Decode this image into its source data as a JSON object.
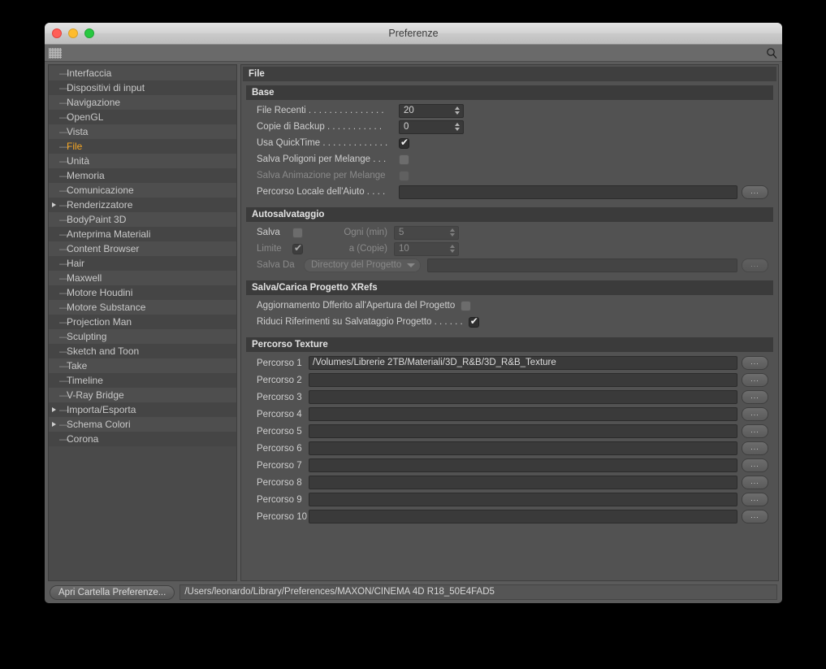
{
  "window": {
    "title": "Preferenze",
    "traffic_lights": [
      "close",
      "minimize",
      "zoom"
    ]
  },
  "search": {
    "icon": "search-icon"
  },
  "sidebar": {
    "items": [
      {
        "label": "Interfaccia",
        "expandable": false,
        "selected": false
      },
      {
        "label": "Dispositivi di input",
        "expandable": false,
        "selected": false
      },
      {
        "label": "Navigazione",
        "expandable": false,
        "selected": false
      },
      {
        "label": "OpenGL",
        "expandable": false,
        "selected": false
      },
      {
        "label": "Vista",
        "expandable": false,
        "selected": false
      },
      {
        "label": "File",
        "expandable": false,
        "selected": true
      },
      {
        "label": "Unità",
        "expandable": false,
        "selected": false
      },
      {
        "label": "Memoria",
        "expandable": false,
        "selected": false
      },
      {
        "label": "Comunicazione",
        "expandable": false,
        "selected": false
      },
      {
        "label": "Renderizzatore",
        "expandable": true,
        "selected": false
      },
      {
        "label": "BodyPaint 3D",
        "expandable": false,
        "selected": false
      },
      {
        "label": "Anteprima Materiali",
        "expandable": false,
        "selected": false
      },
      {
        "label": "Content Browser",
        "expandable": false,
        "selected": false
      },
      {
        "label": "Hair",
        "expandable": false,
        "selected": false
      },
      {
        "label": "Maxwell",
        "expandable": false,
        "selected": false
      },
      {
        "label": "Motore Houdini",
        "expandable": false,
        "selected": false
      },
      {
        "label": "Motore Substance",
        "expandable": false,
        "selected": false
      },
      {
        "label": "Projection Man",
        "expandable": false,
        "selected": false
      },
      {
        "label": "Sculpting",
        "expandable": false,
        "selected": false
      },
      {
        "label": "Sketch and Toon",
        "expandable": false,
        "selected": false
      },
      {
        "label": "Take",
        "expandable": false,
        "selected": false
      },
      {
        "label": "Timeline",
        "expandable": false,
        "selected": false
      },
      {
        "label": "V-Ray Bridge",
        "expandable": false,
        "selected": false
      },
      {
        "label": "Importa/Esporta",
        "expandable": true,
        "selected": false
      },
      {
        "label": "Schema Colori",
        "expandable": true,
        "selected": false
      },
      {
        "label": "Corona",
        "expandable": false,
        "selected": false
      }
    ],
    "selected_color": "#f5a623"
  },
  "main": {
    "pane_title": "File",
    "groups": [
      {
        "title": "Base",
        "rows": [
          {
            "label": "File Recenti . . . . . . . . . . . . . . .",
            "type": "stepper",
            "value": "20",
            "disabled": false,
            "width": 80
          },
          {
            "label": "Copie di Backup . . . . . . . . . . .",
            "type": "stepper",
            "value": "0",
            "disabled": false,
            "width": 80
          },
          {
            "label": "Usa QuickTime . . . . . . . . . . . . .",
            "type": "checkbox",
            "checked": true,
            "disabled": false
          },
          {
            "label": "Salva Poligoni per Melange . . .",
            "type": "checkbox",
            "checked": false,
            "disabled": false
          },
          {
            "label": "Salva Animazione per Melange",
            "type": "checkbox",
            "checked": false,
            "disabled": true
          },
          {
            "label": "Percorso Locale dell'Aiuto . . . .",
            "type": "textfield",
            "value": "",
            "disabled": false,
            "browse": "..."
          }
        ]
      },
      {
        "title": "Autosalvataggio",
        "rows": [
          {
            "type": "dual",
            "left_label": "Salva",
            "left_checked": false,
            "left_disabled": false,
            "right_label": "Ogni (min)",
            "right_value": "5",
            "right_disabled": true
          },
          {
            "type": "dual",
            "left_label": "Limite",
            "left_checked": true,
            "left_disabled": true,
            "right_label": "a (Copie)",
            "right_value": "10",
            "right_disabled": true
          },
          {
            "type": "dropdown_path",
            "label": "Salva Da",
            "dropdown_value": "Directory del Progetto",
            "path_value": "",
            "browse": "...",
            "disabled": true
          }
        ]
      },
      {
        "title": "Salva/Carica Progetto XRefs",
        "rows": [
          {
            "label": "Aggiornamento Dfferito all'Apertura del Progetto",
            "type": "checkbox",
            "checked": false,
            "disabled": false
          },
          {
            "label": "Riduci Riferimenti su Salvataggio Progetto . . . . . .",
            "type": "checkbox",
            "checked": true,
            "disabled": false
          }
        ]
      },
      {
        "title": "Percorso Texture",
        "paths": [
          {
            "label": "Percorso 1",
            "value": "/Volumes/Librerie 2TB/Materiali/3D_R&B/3D_R&B_Texture",
            "browse": "..."
          },
          {
            "label": "Percorso 2",
            "value": "",
            "browse": "..."
          },
          {
            "label": "Percorso 3",
            "value": "",
            "browse": "..."
          },
          {
            "label": "Percorso 4",
            "value": "",
            "browse": "..."
          },
          {
            "label": "Percorso 5",
            "value": "",
            "browse": "..."
          },
          {
            "label": "Percorso 6",
            "value": "",
            "browse": "..."
          },
          {
            "label": "Percorso 7",
            "value": "",
            "browse": "..."
          },
          {
            "label": "Percorso 8",
            "value": "",
            "browse": "..."
          },
          {
            "label": "Percorso 9",
            "value": "",
            "browse": "..."
          },
          {
            "label": "Percorso 10",
            "value": "",
            "browse": "..."
          }
        ]
      }
    ]
  },
  "footer": {
    "button_label": "Apri Cartella Preferenze...",
    "path": "/Users/leonardo/Library/Preferences/MAXON/CINEMA 4D R18_50E4FAD5"
  }
}
